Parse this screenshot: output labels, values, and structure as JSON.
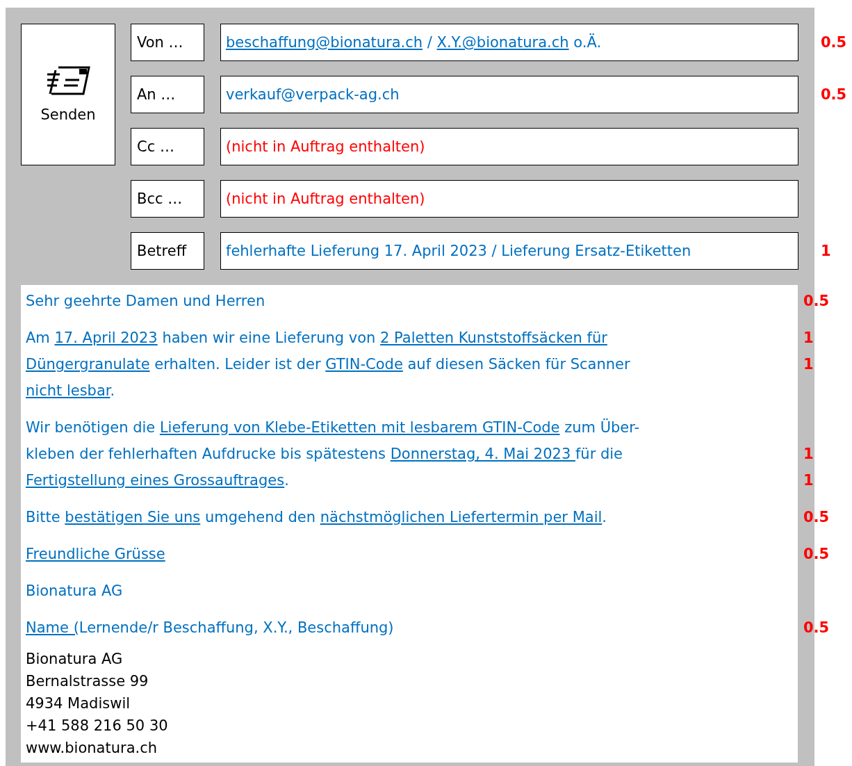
{
  "send_button": {
    "label": "Senden"
  },
  "fields": [
    {
      "label": "Von …",
      "missing": false,
      "score": "0.5",
      "value": [
        {
          "text": "beschaffung@bionatura.ch",
          "underlined": true
        },
        {
          "text": " / ",
          "underlined": false
        },
        {
          "text": "X.Y.@bionatura.ch",
          "underlined": true
        },
        {
          "text": " o.Ä.",
          "underlined": false
        }
      ]
    },
    {
      "label": "An …",
      "missing": false,
      "score": "0.5",
      "value": [
        {
          "text": "verkauf@verpack-ag.ch",
          "underlined": false
        }
      ]
    },
    {
      "label": "Cc …",
      "missing": true,
      "value": [
        {
          "text": "(nicht in Auftrag enthalten)",
          "underlined": false
        }
      ]
    },
    {
      "label": "Bcc …",
      "missing": true,
      "value": [
        {
          "text": "(nicht in Auftrag enthalten)",
          "underlined": false
        }
      ]
    },
    {
      "label": "Betreff",
      "missing": false,
      "score": "1",
      "value": [
        {
          "text": "fehlerhafte Lieferung 17. April 2023 / Lieferung Ersatz-Etiketten",
          "underlined": false
        }
      ]
    }
  ],
  "paragraphs": [
    {
      "lines": [
        {
          "score": "0.5",
          "segments": [
            {
              "text": "Sehr geehrte Damen und Herren",
              "underlined": false
            }
          ]
        }
      ]
    },
    {
      "lines": [
        {
          "score": "1",
          "segments": [
            {
              "text": "Am ",
              "underlined": false
            },
            {
              "text": "17. April 2023",
              "underlined": true
            },
            {
              "text": " haben wir eine Lieferung von ",
              "underlined": false
            },
            {
              "text": "2 Paletten Kunststoffsäcken für",
              "underlined": true
            }
          ]
        },
        {
          "score": "1",
          "segments": [
            {
              "text": "Düngergranulate",
              "underlined": true
            },
            {
              "text": " erhalten. Leider ist der ",
              "underlined": false
            },
            {
              "text": "GTIN-Code",
              "underlined": true
            },
            {
              "text": " auf diesen Säcken für Scanner",
              "underlined": false
            }
          ]
        },
        {
          "segments": [
            {
              "text": "nicht lesbar",
              "underlined": true
            },
            {
              "text": ".",
              "underlined": false
            }
          ]
        }
      ]
    },
    {
      "lines": [
        {
          "segments": [
            {
              "text": "Wir benötigen die ",
              "underlined": false
            },
            {
              "text": "Lieferung von Klebe-Etiketten mit lesbarem GTIN-Code",
              "underlined": true
            },
            {
              "text": " zum Über-",
              "underlined": false
            }
          ]
        },
        {
          "score": "1",
          "segments": [
            {
              "text": "kleben der fehlerhaften Aufdrucke bis spätestens ",
              "underlined": false
            },
            {
              "text": "Donnerstag, 4. Mai 2023 ",
              "underlined": true
            },
            {
              "text": "für die",
              "underlined": false
            }
          ]
        },
        {
          "score": "1",
          "segments": [
            {
              "text": "Fertigstellung eines Grossauftrages",
              "underlined": true
            },
            {
              "text": ".",
              "underlined": false
            }
          ]
        }
      ]
    },
    {
      "lines": [
        {
          "score": "0.5",
          "segments": [
            {
              "text": "Bitte ",
              "underlined": false
            },
            {
              "text": "bestätigen Sie uns",
              "underlined": true
            },
            {
              "text": " umgehend den ",
              "underlined": false
            },
            {
              "text": "nächstmöglichen Liefertermin per Mail",
              "underlined": true
            },
            {
              "text": ".",
              "underlined": false
            }
          ]
        }
      ]
    },
    {
      "lines": [
        {
          "score": "0.5",
          "segments": [
            {
              "text": "Freundliche Grüsse",
              "underlined": true
            }
          ]
        }
      ]
    },
    {
      "lines": [
        {
          "segments": [
            {
              "text": "Bionatura AG",
              "underlined": false
            }
          ]
        }
      ]
    },
    {
      "lines": [
        {
          "score": "0.5",
          "segments": [
            {
              "text": "Name (",
              "underlined": true
            },
            {
              "text": "Lernende/r Beschaffung, X.Y., Beschaffung)",
              "underlined": false
            }
          ]
        }
      ]
    }
  ],
  "signature": [
    "Bionatura AG",
    "Bernalstrasse 99",
    "4934 Madiswil",
    "+41 588 216 50 30",
    "www.bionatura.ch"
  ]
}
